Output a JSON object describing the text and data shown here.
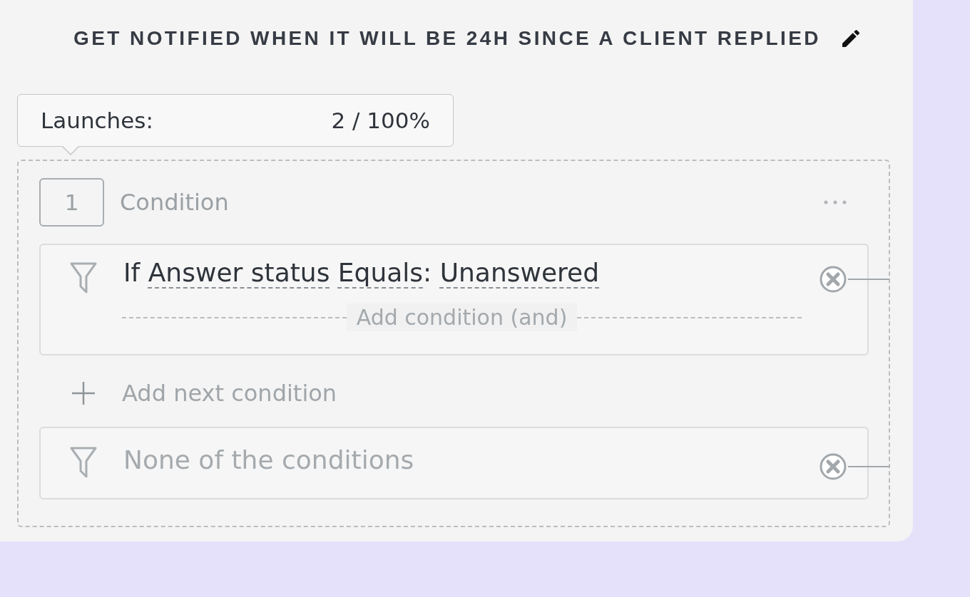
{
  "title": "GET NOTIFIED WHEN IT WILL BE 24H SINCE A CLIENT REPLIED",
  "launches": {
    "label": "Launches:",
    "value": "2 / 100%"
  },
  "step": {
    "number": "1",
    "label": "Condition"
  },
  "conditions": [
    {
      "prefix": "If",
      "field": "Answer status",
      "operator": "Equals",
      "separator": ":",
      "value": "Unanswered",
      "add_label": "Add condition (and)"
    }
  ],
  "add_next": "Add next condition",
  "else_condition": {
    "label": "None of the conditions"
  }
}
